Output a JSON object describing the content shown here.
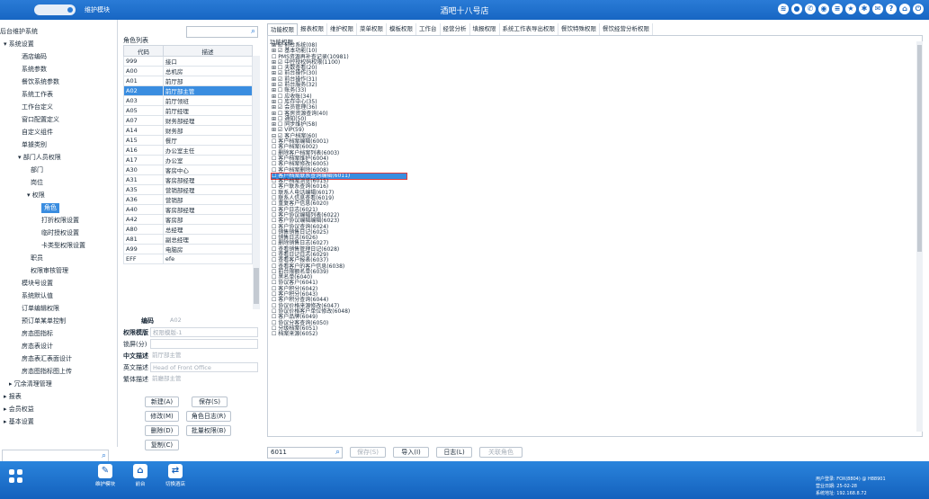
{
  "app": {
    "title": "酒吧十八号店",
    "module": "维护模块"
  },
  "top_icons": [
    "wifi-icon",
    "user-icon",
    "phone-icon",
    "location-icon",
    "menu-icon",
    "star-icon",
    "settings-icon",
    "mail-icon",
    "help-icon",
    "home-icon",
    "power-icon"
  ],
  "left_nav": {
    "items": [
      {
        "label": "后台维护系统",
        "indent": 0
      },
      {
        "label": "▾ 系统设置",
        "indent": 4
      },
      {
        "label": "酒店编码",
        "indent": 24
      },
      {
        "label": "系统参数",
        "indent": 24
      },
      {
        "label": "餐饮系统参数",
        "indent": 24
      },
      {
        "label": "系统工作表",
        "indent": 24
      },
      {
        "label": "工作台定义",
        "indent": 24
      },
      {
        "label": "窗口配置定义",
        "indent": 24
      },
      {
        "label": "自定义组件",
        "indent": 24
      },
      {
        "label": "单據类别",
        "indent": 24
      },
      {
        "label": "▾ 部门人员权限",
        "indent": 20
      },
      {
        "label": "部门",
        "indent": 34
      },
      {
        "label": "岗位",
        "indent": 34
      },
      {
        "label": "▾ 权限",
        "indent": 30
      },
      {
        "label": "角色",
        "indent": 46,
        "selected": true
      },
      {
        "label": "打折权限设置",
        "indent": 46
      },
      {
        "label": "临时授权设置",
        "indent": 46
      },
      {
        "label": "卡类型权限设置",
        "indent": 46
      },
      {
        "label": "职员",
        "indent": 34
      },
      {
        "label": "权限审核管理",
        "indent": 34
      },
      {
        "label": "模块号设置",
        "indent": 24
      },
      {
        "label": "系统默认值",
        "indent": 24
      },
      {
        "label": "订单编辑权限",
        "indent": 24
      },
      {
        "label": "预订单某单控制",
        "indent": 24
      },
      {
        "label": "房态图指标",
        "indent": 24
      },
      {
        "label": "房态表设计",
        "indent": 24
      },
      {
        "label": "房态表汇表面设计",
        "indent": 24
      },
      {
        "label": "房态图指标图上传",
        "indent": 24
      },
      {
        "label": "▸ 冗余清理管理",
        "indent": 10
      },
      {
        "label": "▸ 报表",
        "indent": 4
      },
      {
        "label": "▸ 会员权益",
        "indent": 4
      },
      {
        "label": "▸ 基本设置",
        "indent": 4
      }
    ]
  },
  "roles": {
    "list_label": "角色列表",
    "columns": [
      "代码",
      "描述"
    ],
    "rows": [
      [
        "999",
        "接口"
      ],
      [
        "A00",
        "总机房"
      ],
      [
        "A01",
        "前厅部"
      ],
      [
        "A02",
        "前厅部主管"
      ],
      [
        "A03",
        "前厅领班"
      ],
      [
        "A05",
        "前厅经理"
      ],
      [
        "A07",
        "财务部经理"
      ],
      [
        "A14",
        "财务部"
      ],
      [
        "A15",
        "餐厅"
      ],
      [
        "A16",
        "办公室主任"
      ],
      [
        "A17",
        "办公室"
      ],
      [
        "A30",
        "客房中心"
      ],
      [
        "A31",
        "客房部经理"
      ],
      [
        "A35",
        "营销部经理"
      ],
      [
        "A36",
        "营销部"
      ],
      [
        "A40",
        "客房部经理"
      ],
      [
        "A42",
        "客房部"
      ],
      [
        "A80",
        "总经理"
      ],
      [
        "A81",
        "副总经理"
      ],
      [
        "A99",
        "电脑房"
      ],
      [
        "EFF",
        "efe"
      ]
    ],
    "selected_index": 3
  },
  "detail": {
    "code_label": "编码",
    "code_value": "A02",
    "template_label": "权限模版",
    "template_value": "权限模版-1",
    "lock_label": "锁屏(分)",
    "lock_value": "",
    "cn_label": "中文描述",
    "cn_value": "前厅部主管",
    "en_label": "英文描述",
    "en_value": "Head of Front Office",
    "trad_label": "繁体描述",
    "trad_value": "前廳部主管",
    "buttons": {
      "new": "新建(A)",
      "save": "保存(S)",
      "edit": "修改(M)",
      "role_log": "角色日志(R)",
      "delete": "删除(D)",
      "batch": "批量权限(B)",
      "copy": "复制(C)"
    }
  },
  "tabs": [
    "功能权限",
    "报表权限",
    "维护权限",
    "菜单权限",
    "模板权限",
    "工作台",
    "经营分析",
    "填报权限",
    "系统工作表导出权限",
    "餐饮特殊权限",
    "餐饮经营分析权限"
  ],
  "perm_header": "功能权限",
  "permissions": [
    "⊞ ☑ 前台系统(08)",
    "⊞ ☑ 基本功能(10)",
    "  ☐ PMS资源再补查记录(10981)",
    "⊞ ☑ 中控授权码权限(1100)",
    "⊞ ☐ 天数查看(20)",
    "⊞ ☑ 前台操作(30)",
    "⊞ ☑ 前台操作(31)",
    "⊞ ☑ 前台服务(32)",
    "⊞ ☐ 账务(33)",
    "⊞ ☐ 应收账(34)",
    "⊞ ☐ 库存中心(35)",
    "⊞ ☑ 会员管理(36)",
    "⊞ ☐ 客房资源查询(40)",
    "⊞ ☐ 通知(50)",
    "⊞ ☐ 同步维护(58)",
    "⊞ ☑ VIP(59)",
    "⊟ ☑ 客户档案(60)",
    "    ☐ 客户档案编辑(6001)",
    "    ☐ 客户档案(6002)",
    "    ☐ 删除客户档案列表(6003)",
    "    ☐ 客户档案维护(6004)",
    "    ☐ 客户档案修改(6005)",
    "    ☐ 客户档案删除(6008)",
    "    ☐ 客户档案联系查询编辑(6011)",
    "    ☐ 客户档案浏览(6015)",
    "    ☐ 客户联系查询(6016)",
    "    ☐ 联系人电话编辑(6017)",
    "    ☐ 联系人信息查看(6019)",
    "    ☐ 重复客户信息(6020)",
    "    ☐ 客户日志(6021)",
    "    ☐ 客户协议编辑列表(6022)",
    "    ☐ 客户协议编辑编辑(6023)",
    "    ☐ 客户协议查询(6024)",
    "    ☐ 销售销售日记(6025)",
    "    ☐ 销售日志(6026)",
    "    ☐ 删除销售日志(6027)",
    "    ☐ 查看销售管理日记(6028)",
    "    ☐ 查看日记日志(6029)",
    "    ☐ 查看客户报表(6037)",
    "    ☐ 查看客户的客户信息(6038)",
    "    ☐ 前台限额名单(6039)",
    "    ☐ 黑名单(6040)",
    "    ☐ 协议客户(6041)",
    "    ☐ 客户积分(6042)",
    "    ☐ 客户积分(6043)",
    "    ☐ 客户积分查询(6044)",
    "    ☐ 协议价格来源修改(6047)",
    "    ☐ 协议价格客户单位修改(6048)",
    "    ☐ 客户品牌(6049)",
    "    ☐ 协议分客查询(6050)",
    "    ☐ 分级档案(6051)",
    "    ☐ 档案来源(6052)"
  ],
  "highlight_index": 23,
  "bottom": {
    "code": "6011",
    "save": "保存(S)",
    "import": "导入(I)",
    "log": "日志(L)",
    "related": "关联角色"
  },
  "dock": {
    "items": [
      {
        "label": "维护模块",
        "glyph": "✎"
      },
      {
        "label": "前台",
        "glyph": "⌂"
      },
      {
        "label": "切换酒店",
        "glyph": "⇄"
      }
    ],
    "info": [
      "用户登录: FOX(8804) @ H88901",
      "营业日期: 25-02-28",
      "系统地址: 192.168.8.72"
    ]
  }
}
